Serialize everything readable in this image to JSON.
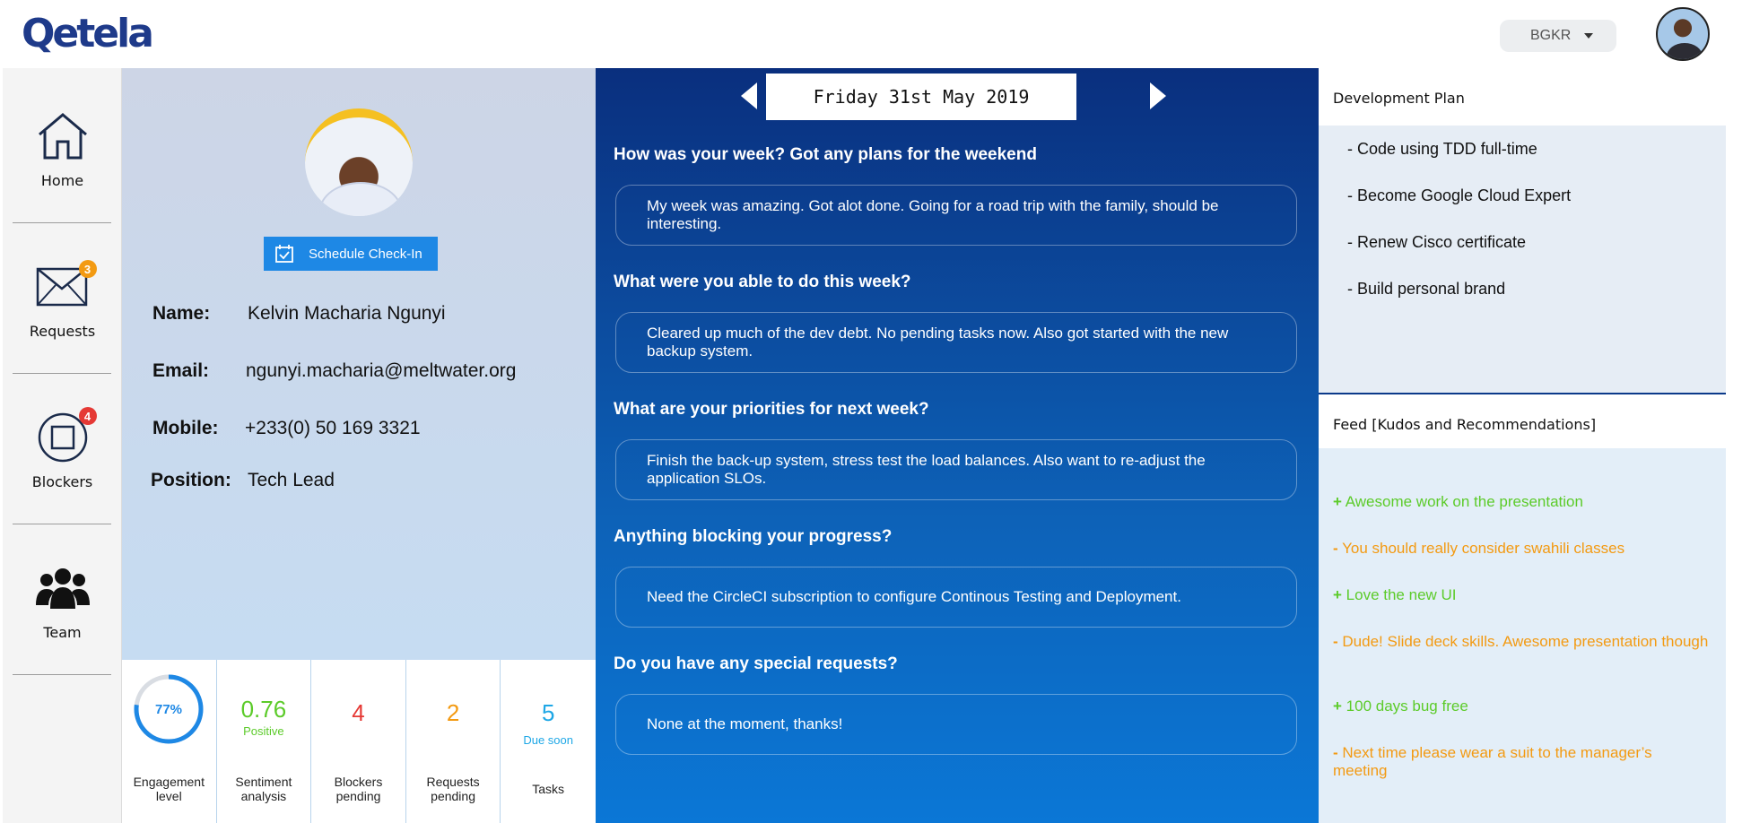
{
  "app": {
    "logo_text": "Qetela"
  },
  "header": {
    "org_select_value": "BGKR",
    "profile_avatar_icon": "user-avatar"
  },
  "nav": {
    "items": [
      {
        "label": "Home",
        "icon": "home-icon"
      },
      {
        "label": "Requests",
        "icon": "mail-icon",
        "badge": "3",
        "badge_color": "#f39a12"
      },
      {
        "label": "Blockers",
        "icon": "blocker-icon",
        "badge": "4",
        "badge_color": "#e53935"
      },
      {
        "label": "Team",
        "icon": "team-icon"
      }
    ]
  },
  "profile": {
    "checkin_button": "Schedule Check-In",
    "fields": [
      {
        "label": "Name:",
        "value": "Kelvin Macharia Ngunyi"
      },
      {
        "label": "Email:",
        "value": "ngunyi.macharia@meltwater.org"
      },
      {
        "label": "Mobile:",
        "value": "+233(0) 50 169 3321"
      },
      {
        "label": "Position:",
        "value": "Tech Lead"
      }
    ]
  },
  "stats": {
    "engagement": {
      "value": "77%",
      "fraction": 0.77,
      "caption": "Engagement level"
    },
    "sentiment": {
      "value": "0.76",
      "sub": "Positive",
      "caption": "Sentiment analysis"
    },
    "blockers": {
      "value": "4",
      "caption": "Blockers pending"
    },
    "requests": {
      "value": "2",
      "caption": "Requests pending"
    },
    "tasks": {
      "value": "5",
      "sub": "Due soon",
      "caption": "Tasks"
    }
  },
  "checkin": {
    "date": "Friday 31st May 2019",
    "qa": [
      {
        "q": "How was your week? Got any plans for the weekend",
        "a": "My week was amazing. Got alot done. Going for a road trip with the family, should be interesting."
      },
      {
        "q": "What were you able to do this week?",
        "a": "Cleared up much of the dev debt. No pending tasks now. Also got started with the new backup system."
      },
      {
        "q": "What are your priorities for next week?",
        "a": "Finish the back-up system, stress test the load balances. Also want to re-adjust the application SLOs."
      },
      {
        "q": "Anything blocking your progress?",
        "a": "Need the CircleCI subscription to configure Continous Testing and Deployment."
      },
      {
        "q": "Do you have any special requests?",
        "a": "None at the moment, thanks!"
      }
    ]
  },
  "devplan": {
    "title": "Development Plan",
    "items": [
      "- Code using TDD full-time",
      "- Become Google Cloud Expert",
      "- Renew Cisco certificate",
      "- Build personal brand"
    ]
  },
  "feed": {
    "title": "Feed [Kudos and Recommendations]",
    "items": [
      {
        "sign": "+",
        "text": "Awesome work on the presentation",
        "color": "#5ccb2a"
      },
      {
        "sign": "-",
        "text": "You should really consider swahili classes",
        "color": "#f39a12"
      },
      {
        "sign": "+",
        "text": "Love the new UI",
        "color": "#5ccb2a"
      },
      {
        "sign": "-",
        "text": "Dude! Slide deck skills. Awesome presentation though",
        "color": "#f39a12"
      },
      {
        "sign": "+",
        "text": "100 days bug free",
        "color": "#5ccb2a"
      },
      {
        "sign": "-",
        "text": "Next time please wear a suit to the manager’s meeting",
        "color": "#f39a12"
      }
    ]
  }
}
